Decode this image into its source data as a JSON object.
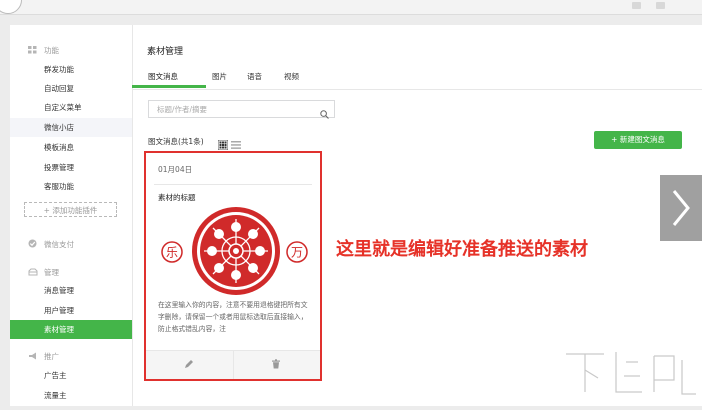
{
  "sidebar": {
    "sections": [
      {
        "label": "功能",
        "icon": "grid-icon",
        "items": [
          {
            "label": "群发功能"
          },
          {
            "label": "自动回复"
          },
          {
            "label": "自定义菜单"
          },
          {
            "label": "微信小店"
          },
          {
            "label": "模板消息"
          },
          {
            "label": "投票管理"
          },
          {
            "label": "客服功能"
          }
        ]
      },
      {
        "label": "微信支付",
        "icon": "check-circle-icon",
        "items": []
      },
      {
        "label": "管理",
        "icon": "folder-icon",
        "items": [
          {
            "label": "消息管理"
          },
          {
            "label": "用户管理"
          },
          {
            "label": "素材管理"
          }
        ]
      },
      {
        "label": "推广",
        "icon": "megaphone-icon",
        "items": [
          {
            "label": "广告主"
          },
          {
            "label": "流量主"
          }
        ]
      }
    ],
    "add_plugin_label": "+ 添加功能插件",
    "active_item": "素材管理",
    "highlighted_item": "微信小店"
  },
  "main": {
    "title": "素材管理",
    "tabs": [
      {
        "label": "图文消息"
      },
      {
        "label": "图片"
      },
      {
        "label": "语音"
      },
      {
        "label": "视频"
      }
    ],
    "search_placeholder": "标题/作者/摘要",
    "count_text": "图文消息(共1条)",
    "new_button_label": "+ 新建图文消息",
    "card": {
      "date": "01月04日",
      "title": "素材的标题",
      "cover_left_char": "乐",
      "cover_right_char": "万",
      "description": "在这里输入你的内容，注意不要用退格键把所有文字删除，请保留一个或者用鼠标选取后直接输入，防止格式错乱内容，注"
    }
  },
  "annotation_text": "这里就是编辑好准备推送的素材",
  "colors": {
    "accent": "#44b549",
    "highlight_border": "#e0312e",
    "annotation": "#e63228"
  }
}
